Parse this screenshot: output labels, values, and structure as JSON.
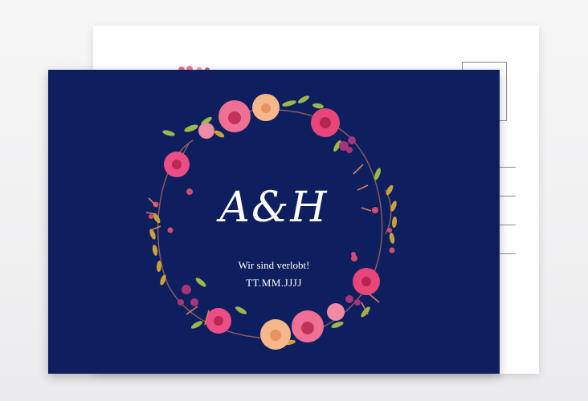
{
  "card": {
    "monogram": "A&H",
    "subtitle": "Wir sind verlobt!",
    "date_placeholder": "TT.MM.JJJJ"
  },
  "colors": {
    "front_background": "#0e1f5f",
    "back_background": "#ffffff",
    "text": "#ffffff",
    "flower_pink": "#e8467a",
    "flower_peach": "#f6b88a",
    "leaf_green": "#9bb848",
    "leaf_gold": "#c9a13a"
  }
}
